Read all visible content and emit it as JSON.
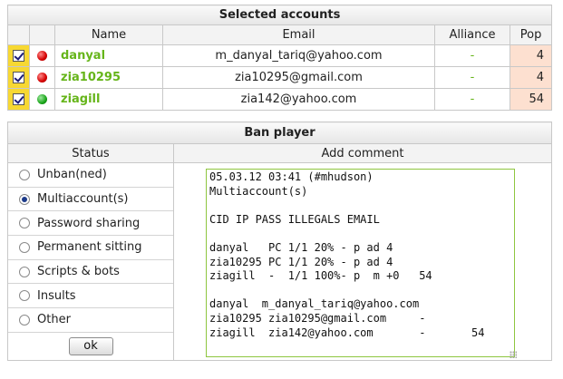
{
  "accounts": {
    "title": "Selected accounts",
    "columns": [
      "Name",
      "Email",
      "Alliance",
      "Pop"
    ],
    "rows": [
      {
        "name": "danyal",
        "email": "m_danyal_tariq@yahoo.com",
        "alliance": "-",
        "pop": "4",
        "status": "red",
        "checked": true
      },
      {
        "name": "zia10295",
        "email": "zia10295@gmail.com",
        "alliance": "-",
        "pop": "4",
        "status": "red",
        "checked": true
      },
      {
        "name": "ziagill",
        "email": "zia142@yahoo.com",
        "alliance": "-",
        "pop": "54",
        "status": "green",
        "checked": true
      }
    ]
  },
  "ban": {
    "title": "Ban player",
    "status_header": "Status",
    "comment_header": "Add comment",
    "options": [
      {
        "label": "Unban(ned)",
        "checked": false
      },
      {
        "label": "Multiaccount(s)",
        "checked": true
      },
      {
        "label": "Password sharing",
        "checked": false
      },
      {
        "label": "Permanent sitting",
        "checked": false
      },
      {
        "label": "Scripts & bots",
        "checked": false
      },
      {
        "label": "Insults",
        "checked": false
      },
      {
        "label": "Other",
        "checked": false
      }
    ],
    "ok_label": "ok",
    "comment": "05.03.12 03:41 (#mhudson)\nMultiaccount(s)\n\nCID IP PASS ILLEGALS EMAIL\n\ndanyal   PC 1/1 20% - p ad 4\nzia10295 PC 1/1 20% - p ad 4\nziagill  -  1/1 100%- p  m +0   54\n\ndanyal  m_danyal_tariq@yahoo.com\nzia10295 zia10295@gmail.com     -\nziagill  zia142@yahoo.com       -       54"
  },
  "colors": {
    "name_green": "#66b51a",
    "checkbox_bg": "#f7d832",
    "pop_bg": "#fde0d0",
    "comment_border": "#8ec63f"
  }
}
